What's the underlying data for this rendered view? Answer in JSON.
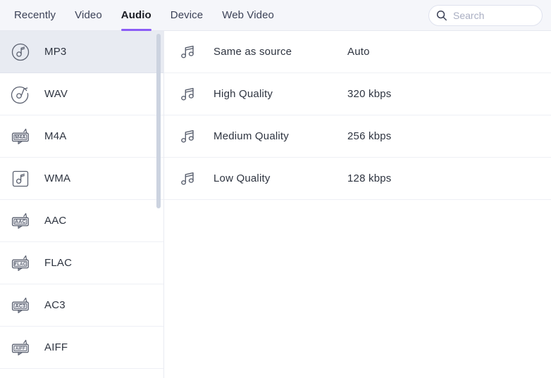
{
  "header": {
    "tabs": [
      {
        "label": "Recently",
        "active": false
      },
      {
        "label": "Video",
        "active": false
      },
      {
        "label": "Audio",
        "active": true
      },
      {
        "label": "Device",
        "active": false
      },
      {
        "label": "Web Video",
        "active": false
      }
    ],
    "search": {
      "placeholder": "Search",
      "value": "",
      "icon": "search-icon"
    },
    "accent_color": "#8b5cf6",
    "background_color": "#f5f6fa"
  },
  "sidebar": {
    "selected": "MP3",
    "selected_background": "#e8ebf2",
    "scrollbar": {
      "visible": true,
      "thumb_color": "#ccd3e0"
    },
    "items": [
      {
        "label": "MP3",
        "icon": "mp3-format-icon",
        "icon_style": "disc",
        "badge": "",
        "selected": true
      },
      {
        "label": "WAV",
        "icon": "wav-format-icon",
        "icon_style": "disc2",
        "badge": "",
        "selected": false
      },
      {
        "label": "M4A",
        "icon": "m4a-format-icon",
        "icon_style": "tag",
        "badge": "M4A",
        "selected": false
      },
      {
        "label": "WMA",
        "icon": "wma-format-icon",
        "icon_style": "square",
        "badge": "",
        "selected": false
      },
      {
        "label": "AAC",
        "icon": "aac-format-icon",
        "icon_style": "tag",
        "badge": "AAC",
        "selected": false
      },
      {
        "label": "FLAC",
        "icon": "flac-format-icon",
        "icon_style": "tag",
        "badge": "FLAC",
        "selected": false
      },
      {
        "label": "AC3",
        "icon": "ac3-format-icon",
        "icon_style": "tag",
        "badge": "AC3",
        "selected": false
      },
      {
        "label": "AIFF",
        "icon": "aiff-format-icon",
        "icon_style": "tag",
        "badge": "AIFF",
        "selected": false
      }
    ]
  },
  "content": {
    "rows": [
      {
        "name": "Same as source",
        "value": "Auto",
        "icon": "music-note-icon"
      },
      {
        "name": "High Quality",
        "value": "320 kbps",
        "icon": "music-note-icon"
      },
      {
        "name": "Medium Quality",
        "value": "256 kbps",
        "icon": "music-note-icon"
      },
      {
        "name": "Low Quality",
        "value": "128 kbps",
        "icon": "music-note-icon"
      }
    ]
  }
}
